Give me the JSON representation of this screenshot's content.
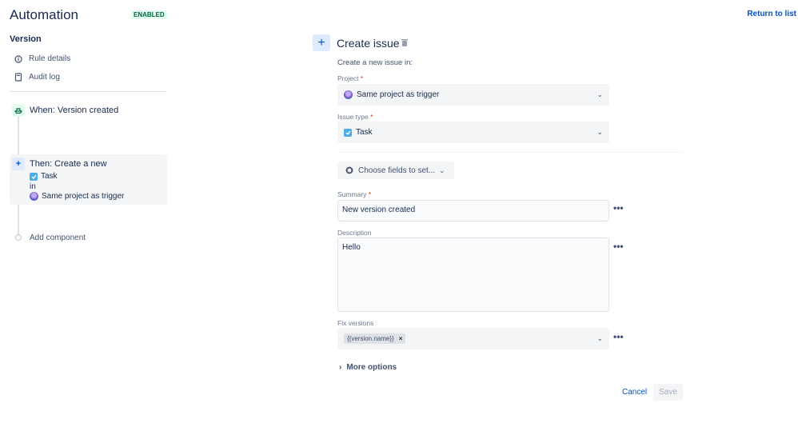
{
  "header": {
    "title": "Automation",
    "status": "ENABLED",
    "return_link": "Return to list"
  },
  "sidebar": {
    "section": "Version",
    "nav": [
      {
        "label": "Rule details",
        "icon": "info-icon"
      },
      {
        "label": "Audit log",
        "icon": "audit-log-icon"
      }
    ],
    "trigger": {
      "label": "When: Version created",
      "icon": "version-ship-icon"
    },
    "action": {
      "label": "Then: Create a new",
      "issue_type": "Task",
      "connector": "in",
      "project": "Same project as trigger"
    },
    "add_component": "Add component"
  },
  "form": {
    "title": "Create issue",
    "intro": "Create a new issue in:",
    "project": {
      "label": "Project",
      "value": "Same project as trigger"
    },
    "issue_type": {
      "label": "Issue type",
      "value": "Task"
    },
    "choose_fields": "Choose fields to set...",
    "summary": {
      "label": "Summary",
      "value": "New version created"
    },
    "description": {
      "label": "Description",
      "value": "Hello"
    },
    "fix_versions": {
      "label": "Fix versions",
      "tag": "{{version.name}}"
    },
    "more_options": "More options",
    "cancel": "Cancel",
    "save": "Save"
  },
  "colors": {
    "accent": "#0052cc",
    "enabled_bg": "#e3fcef",
    "required": "#de350b"
  }
}
